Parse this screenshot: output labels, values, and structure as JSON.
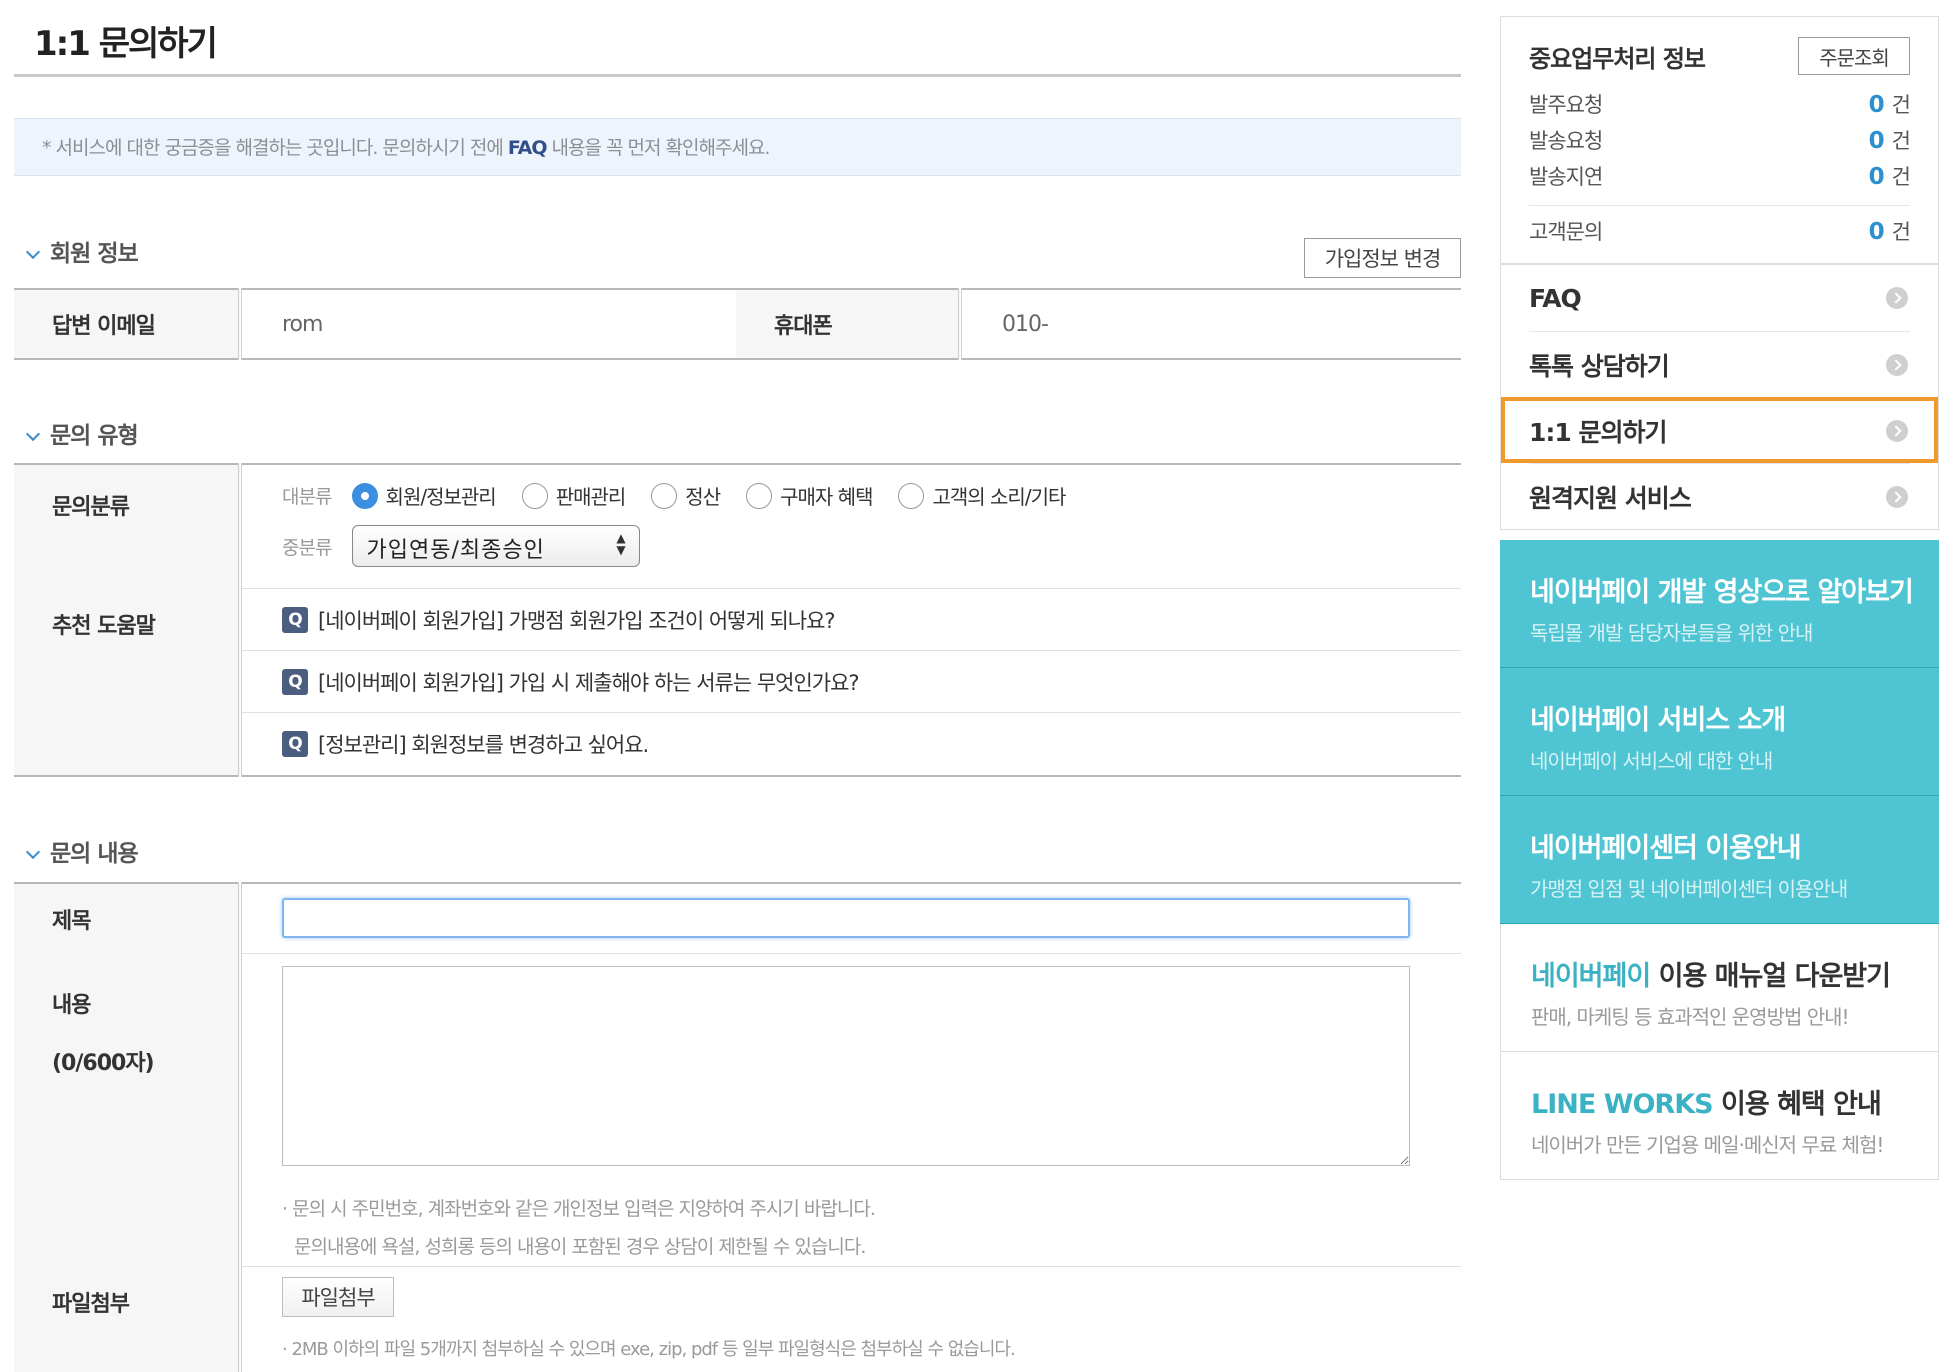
{
  "page": {
    "title": "1:1 문의하기",
    "notice_prefix": "* 서비스에 대한 궁금증을 해결하는 곳입니다. 문의하시기 전에 ",
    "notice_bold": "FAQ",
    "notice_suffix": " 내용을 꼭 먼저 확인해주세요."
  },
  "member_section": {
    "heading": "회원 정보",
    "edit_button": "가입정보 변경",
    "email_label": "답변 이메일",
    "email_value": "rom",
    "phone_label": "휴대폰",
    "phone_value": "010-"
  },
  "type_section": {
    "heading": "문의 유형",
    "category_label": "문의분류",
    "major_label": "대분류",
    "options": [
      "회원/정보관리",
      "판매관리",
      "정산",
      "구매자 혜택",
      "고객의 소리/기타"
    ],
    "selected_index": 0,
    "minor_label": "중분류",
    "minor_selected": "가입연동/최종승인",
    "help_label": "추천 도움말",
    "help_badge": "Q",
    "help_items": [
      "[네이버페이 회원가입] 가맹점 회원가입 조건이 어떻게 되나요?",
      "[네이버페이 회원가입] 가입 시 제출해야 하는 서류는 무엇인가요?",
      "[정보관리] 회원정보를 변경하고 싶어요."
    ]
  },
  "content_section": {
    "heading": "문의 내용",
    "subject_label": "제목",
    "subject_value": "",
    "body_label": "내용",
    "body_count": "(0/600자)",
    "body_value": "",
    "note1": "문의 시 주민번호, 계좌번호와 같은 개인정보 입력은 지양하여 주시기 바랍니다.",
    "note2": "문의내용에 욕설, 성희롱 등의 내용이 포함된 경우 상담이 제한될 수 있습니다.",
    "file_label": "파일첨부",
    "file_button": "파일첨부",
    "file_note": "2MB 이하의 파일 5개까지 첨부하실 수 있으며 exe, zip, pdf 등 일부 파일형식은 첨부하실 수 없습니다."
  },
  "aside": {
    "biz_title": "중요업무처리 정보",
    "order_button": "주문조회",
    "biz_rows": [
      {
        "label": "발주요청",
        "count": "0",
        "unit": "건"
      },
      {
        "label": "발송요청",
        "count": "0",
        "unit": "건"
      },
      {
        "label": "발송지연",
        "count": "0",
        "unit": "건"
      },
      {
        "label": "고객문의",
        "count": "0",
        "unit": "건"
      }
    ],
    "menu": [
      "FAQ",
      "톡톡 상담하기",
      "1:1 문의하기",
      "원격지원 서비스"
    ],
    "active_menu_index": 2,
    "active_outline_color": "#f09a2e",
    "promos": [
      {
        "title": "네이버페이 개발 영상으로 알아보기",
        "sub": "독립몰 개발 담당자분들을 위한 안내"
      },
      {
        "title": "네이버페이 서비스 소개",
        "sub": "네이버페이 서비스에 대한 안내"
      },
      {
        "title": "네이버페이센터 이용안내",
        "sub": "가맹점 입점 및 네이버페이센터 이용안내"
      }
    ],
    "manual": {
      "title_hl": "네이버페이",
      "title_rest": " 이용 매뉴얼 다운받기",
      "sub": "판매, 마케팅 등 효과적인 운영방법 안내!"
    },
    "lineworks": {
      "title_hl": "LINE WORKS",
      "title_rest": " 이용 혜택 안내",
      "sub": "네이버가 만든 기업용 메일·메신저 무료 체험!"
    }
  },
  "colors": {
    "teal": "#4fc4d2",
    "accent_blue": "#3c8ee0",
    "highlight_orange": "#f09a2e"
  }
}
